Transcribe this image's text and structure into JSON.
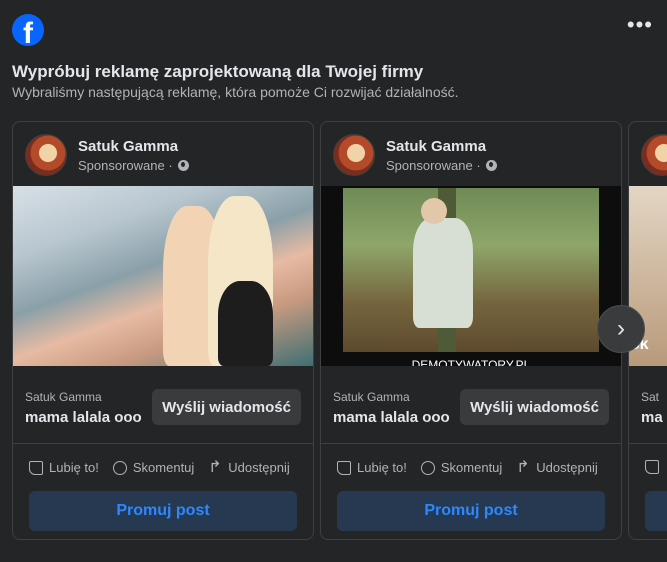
{
  "header": {
    "title": "Wypróbuj reklamę zaprojektowaną dla Twojej firmy",
    "subtitle": "Wybraliśmy następującą reklamę, która pomoże Ci rozwijać działalność.",
    "more_label": "•••"
  },
  "cards": [
    {
      "page_name": "Satuk Gamma",
      "sponsored": "Sponsorowane ·",
      "label": "Satuk Gamma",
      "message": "mama lalala ooo",
      "send_label": "Wyślij wiadomość",
      "like": "Lubię to!",
      "comment": "Skomentuj",
      "share": "Udostępnij",
      "promote": "Promuj post"
    },
    {
      "page_name": "Satuk Gamma",
      "sponsored": "Sponsorowane ·",
      "label": "Satuk Gamma",
      "message": "mama lalala ooo",
      "send_label": "Wyślij wiadomość",
      "like": "Lubię to!",
      "comment": "Skomentuj",
      "share": "Udostępnij",
      "promote": "Promuj post",
      "image_caption": "DEMOTYWATORY.PL"
    },
    {
      "page_name": "",
      "sponsored": "",
      "label": "Sat",
      "message": "ma",
      "image_text": "Sk"
    }
  ],
  "icons": {
    "logo": "facebook-logo",
    "next": "chevron-right-icon"
  },
  "colors": {
    "background": "#242526",
    "accent": "#2d88ff",
    "promote_bg": "#263951"
  }
}
